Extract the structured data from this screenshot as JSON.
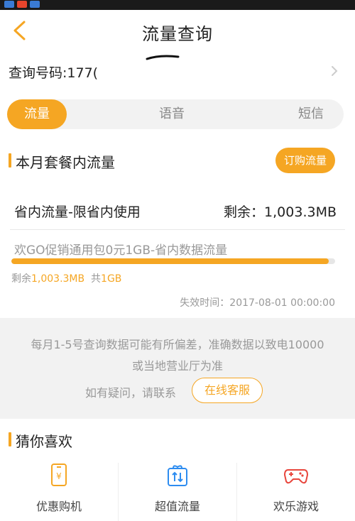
{
  "nav": {
    "title": "流量查询"
  },
  "query": {
    "label": "查询号码:177("
  },
  "tabs": [
    {
      "label": "流量",
      "active": true
    },
    {
      "label": "语音",
      "active": false
    },
    {
      "label": "短信",
      "active": false
    }
  ],
  "plan": {
    "section_title": "本月套餐内流量",
    "buy_label": "订购流量",
    "package_name": "省内流量-限省内使用",
    "remaining_text": "剩余：1,003.3MB",
    "sub_package": "欢GO促销通用包0元1GB-省内数据流量",
    "remain_prefix": "剩余",
    "remain_value": "1,003.3MB",
    "total_prefix": "共",
    "total_value": "1GB",
    "usage_fraction": 0.98,
    "expire_text": "失效时间：2017-08-01 00:00:00"
  },
  "notice": {
    "line1": "每月1-5号查询数据可能有所偏差，准确数据以致电10000",
    "line2": "或当地营业厅为准",
    "ask": "如有疑问，请联系",
    "cs_button": "在线客服"
  },
  "recommend": {
    "section_title": "猜你喜欢",
    "items": [
      {
        "label": "优惠购机",
        "icon": "phone-icon"
      },
      {
        "label": "超值流量",
        "icon": "data-gift-icon"
      },
      {
        "label": "欢乐游戏",
        "icon": "gamepad-icon"
      }
    ]
  },
  "colors": {
    "accent": "#f5a623",
    "accent_red": "#e8453c",
    "accent_blue": "#2d8cf0"
  }
}
